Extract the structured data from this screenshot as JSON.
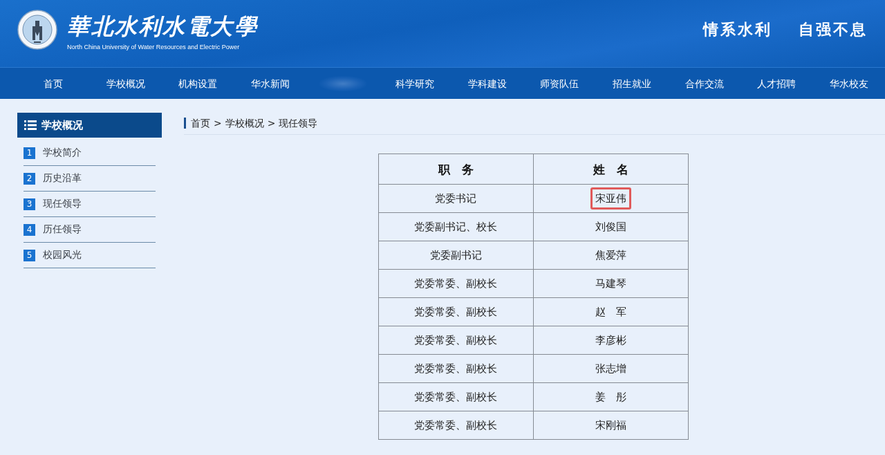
{
  "header": {
    "title": "華北水利水電大學",
    "subtitle": "North China University of Water Resources and Electric Power",
    "slogans": [
      "情系水利",
      "自强不息"
    ]
  },
  "nav": {
    "items": [
      {
        "kind": "link",
        "label": "首页"
      },
      {
        "kind": "link",
        "label": "学校概况"
      },
      {
        "kind": "link",
        "label": "机构设置"
      },
      {
        "kind": "link",
        "label": "华水新闻"
      },
      {
        "kind": "blurred"
      },
      {
        "kind": "link",
        "label": "科学研究"
      },
      {
        "kind": "link",
        "label": "学科建设"
      },
      {
        "kind": "link",
        "label": "师资队伍"
      },
      {
        "kind": "link",
        "label": "招生就业"
      },
      {
        "kind": "link",
        "label": "合作交流"
      },
      {
        "kind": "link",
        "label": "人才招聘"
      },
      {
        "kind": "link",
        "label": "华水校友"
      }
    ]
  },
  "sidebar": {
    "title": "学校概况",
    "items": [
      {
        "number": "1",
        "label": "学校简介"
      },
      {
        "number": "2",
        "label": "历史沿革"
      },
      {
        "number": "3",
        "label": "现任领导"
      },
      {
        "number": "4",
        "label": "历任领导"
      },
      {
        "number": "5",
        "label": "校园风光"
      }
    ]
  },
  "breadcrumb": {
    "items": [
      "首页",
      "学校概况",
      "现任领导"
    ],
    "separator": ">"
  },
  "table": {
    "columns": [
      "职　务",
      "姓　名"
    ],
    "rows": [
      {
        "position": "党委书记",
        "name": "宋亚伟",
        "highlighted": true
      },
      {
        "position": "党委副书记、校长",
        "name": "刘俊国",
        "highlighted": false
      },
      {
        "position": "党委副书记",
        "name": "焦爱萍",
        "highlighted": false
      },
      {
        "position": "党委常委、副校长",
        "name": "马建琴",
        "highlighted": false
      },
      {
        "position": "党委常委、副校长",
        "name": "赵　军",
        "highlighted": false
      },
      {
        "position": "党委常委、副校长",
        "name": "李彦彬",
        "highlighted": false
      },
      {
        "position": "党委常委、副校长",
        "name": "张志增",
        "highlighted": false
      },
      {
        "position": "党委常委、副校长",
        "name": "姜　彤",
        "highlighted": false
      },
      {
        "position": "党委常委、副校长",
        "name": "宋刚福",
        "highlighted": false
      }
    ]
  }
}
